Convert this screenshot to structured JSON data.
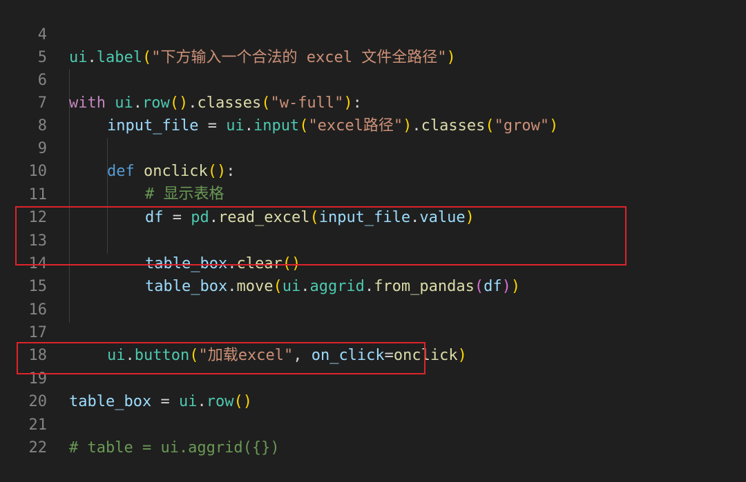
{
  "editor": {
    "lines": [
      {
        "number": "4"
      },
      {
        "number": "5"
      },
      {
        "number": "6"
      },
      {
        "number": "7"
      },
      {
        "number": "8"
      },
      {
        "number": "9"
      },
      {
        "number": "10"
      },
      {
        "number": "11"
      },
      {
        "number": "12"
      },
      {
        "number": "13"
      },
      {
        "number": "14"
      },
      {
        "number": "15"
      },
      {
        "number": "16"
      },
      {
        "number": "17"
      },
      {
        "number": "18"
      },
      {
        "number": "19"
      },
      {
        "number": "20"
      },
      {
        "number": "21"
      },
      {
        "number": "22"
      }
    ],
    "tokens": {
      "l4": [
        "ui",
        ".",
        "label",
        "(",
        "\"下方输入一个合法的 excel 文件全路径\"",
        ")"
      ],
      "l6": [
        "with",
        " ",
        "ui",
        ".",
        "row",
        "(",
        ")",
        ".",
        "classes",
        "(",
        "\"w-full\"",
        ")",
        ":"
      ],
      "l7": [
        "input_file",
        " = ",
        "ui",
        ".",
        "input",
        "(",
        "\"excel路径\"",
        ")",
        ".",
        "classes",
        "(",
        "\"grow\"",
        ")"
      ],
      "l9": [
        "def",
        " ",
        "onclick",
        "(",
        ")",
        ":"
      ],
      "l10": [
        "# 显示表格"
      ],
      "l11": [
        "df",
        " = ",
        "pd",
        ".",
        "read_excel",
        "(",
        "input_file",
        ".",
        "value",
        ")"
      ],
      "l13": [
        "table_box",
        ".",
        "clear",
        "(",
        ")"
      ],
      "l14": [
        "table_box",
        ".",
        "move",
        "(",
        "ui",
        ".",
        "aggrid",
        ".",
        "from_pandas",
        "(",
        "df",
        ")",
        ")"
      ],
      "l17": [
        "ui",
        ".",
        "button",
        "(",
        "\"加载excel\"",
        ", ",
        "on_click",
        "=",
        "onclick",
        ")"
      ],
      "l19": [
        "table_box",
        " = ",
        "ui",
        ".",
        "row",
        "(",
        ")"
      ],
      "l21": [
        "# table = ui.aggrid({})"
      ]
    }
  },
  "highlight_color": "#e0232b"
}
